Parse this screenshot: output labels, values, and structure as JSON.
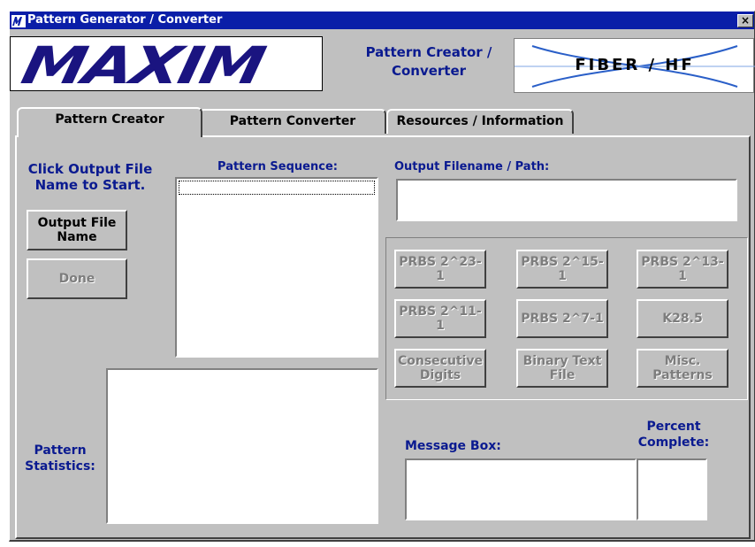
{
  "window": {
    "title": "Pattern Generator / Converter",
    "close_glyph": "×"
  },
  "header": {
    "brand": "MAXIM",
    "title": "Pattern Creator / Converter",
    "fiber_logo_text": "FIBER / HF"
  },
  "tabs": [
    {
      "label": "Pattern Creator",
      "active": true
    },
    {
      "label": "Pattern Converter",
      "active": false
    },
    {
      "label": "Resources / Information",
      "active": false
    }
  ],
  "creator": {
    "start_hint": "Click Output File Name to Start.",
    "output_file_button": "Output File Name",
    "done_button": "Done",
    "pattern_sequence_label": "Pattern Sequence:",
    "pattern_statistics_label": "Pattern Statistics:",
    "output_filename_label": "Output Filename / Path:",
    "output_filename_value": "",
    "pattern_buttons": [
      {
        "label": "PRBS 2^23-1"
      },
      {
        "label": "PRBS 2^15-1"
      },
      {
        "label": "PRBS 2^13-1"
      },
      {
        "label": "PRBS 2^11-1"
      },
      {
        "label": "PRBS 2^7-1"
      },
      {
        "label": "K28.5"
      },
      {
        "label": "Consecutive Digits"
      },
      {
        "label": "Binary Text File"
      },
      {
        "label": "Misc. Patterns"
      }
    ],
    "message_box_label": "Message Box:",
    "percent_complete_label": "Percent Complete:"
  },
  "colors": {
    "titlebar": "#0a1ea8",
    "label_blue": "#0a1a90",
    "face": "#c0c0c0"
  }
}
